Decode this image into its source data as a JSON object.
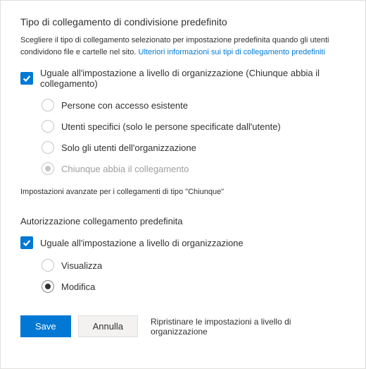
{
  "section1": {
    "title": "Tipo di collegamento di condivisione predefinito",
    "description_before": "Scegliere il tipo di collegamento selezionato per impostazione predefinita quando gli utenti condividono file e cartelle nel sito. ",
    "description_link": "Ulteriori informazioni sui tipi di collegamento predefiniti",
    "checkbox_label": "Uguale all'impostazione a livello di organizzazione (Chiunque abbia il collegamento)",
    "radios": {
      "r1": "Persone con accesso esistente",
      "r2": "Utenti specifici (solo le persone specificate dall'utente)",
      "r3": "Solo gli utenti dell'organizzazione",
      "r4": "Chiunque abbia il collegamento"
    },
    "advanced": "Impostazioni avanzate per i collegamenti di tipo \"Chiunque\""
  },
  "section2": {
    "title": "Autorizzazione collegamento predefinita",
    "checkbox_label": "Uguale all'impostazione a livello di organizzazione",
    "radios": {
      "r1": "Visualizza",
      "r2": "Modifica"
    }
  },
  "footer": {
    "save": "Save",
    "cancel": "Annulla",
    "reset": "Ripristinare le impostazioni a livello di organizzazione"
  }
}
